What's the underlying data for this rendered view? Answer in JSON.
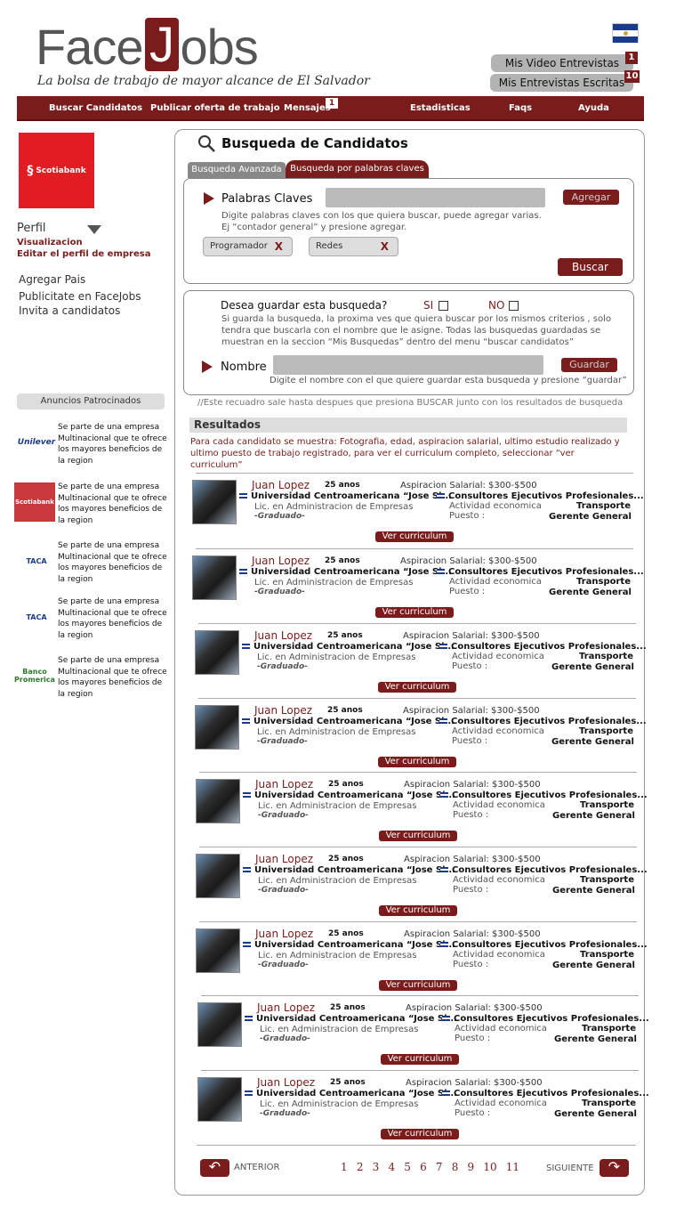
{
  "header": {
    "logo_text_a": "Face",
    "logo_text_j": "J",
    "logo_text_b": "obs",
    "tagline": "La bolsa de trabajo de mayor alcance de El Salvador",
    "video_btn": "Mis Video Entrevistas",
    "video_count": "1",
    "written_btn": "Mis Entrevistas Escritas",
    "written_count": "10"
  },
  "nav": {
    "items": [
      "Buscar Candidatos",
      "Publicar oferta de trabajo",
      "Mensajes",
      "Estadisticas",
      "Faqs",
      "Ayuda"
    ],
    "messages_count": "1"
  },
  "sidebar": {
    "company_logo": "Scotiabank",
    "perfil": "Perfil",
    "visualizacion": "Visualizacion",
    "edit_profile": "Editar el perfil de empresa",
    "links": [
      "Agregar Pais",
      "Publicitate en FaceJobs",
      "Invita a candidatos"
    ],
    "ads_title": "Anuncios Patrocinados",
    "ads": [
      {
        "logo": "Unilever",
        "text": "Se parte de una empresa Multinacional que te ofrece los mayores beneficios de la region"
      },
      {
        "logo": "Scotiabank",
        "text": "Se parte de una empresa Multinacional que te ofrece los mayores beneficios de la region"
      },
      {
        "logo": "TACA",
        "text": "Se parte de una empresa Multinacional que te ofrece los mayores beneficios de la region"
      },
      {
        "logo": "TACA",
        "text": "Se parte de una empresa Multinacional que te ofrece los mayores beneficios de la region"
      },
      {
        "logo": "Banco Promerica",
        "text": "Se parte de una empresa Multinacional que te ofrece los mayores beneficios de la region"
      }
    ]
  },
  "search": {
    "title": "Busqueda de Candidatos",
    "tab_advanced": "Busqueda Avanzada",
    "tab_keywords": "Busqueda por palabras claves",
    "keywords_label": "Palabras Claves",
    "add_btn": "Agregar",
    "keywords_hint1": "Digite palabras claves con los que quiera buscar, puede agregar varias.",
    "keywords_hint2": "Ej “contador general”  y presione agregar.",
    "tags": [
      "Programador",
      "Redes"
    ],
    "tag_remove": "X",
    "search_btn": "Buscar",
    "save_question": "Desea guardar esta busqueda?",
    "yes": "SI",
    "no": "NO",
    "save_hint": "Si guarda la busqueda, la proxima ves que quiera buscar por los mismos criterios , solo tendra que buscarla  con el nombre que le asigne. Todas las busquedas guardadas se muestran   en la seccion  “Mis Busquedas” dentro del menu “buscar candidatos”",
    "name_label": "Nombre",
    "save_btn": "Guardar",
    "name_hint": "Digite el nombre con el que quiere guardar esta busqueda y presione “guardar”",
    "note": "//Este recuadro sale hasta despues que presiona BUSCAR junto con los resultados de busqueda"
  },
  "results": {
    "title": "Resultados",
    "description": "Para cada candidato se muestra: Fotografia, edad, aspiracion salarial, ultimo estudio realizado y ultimo puesto de trabajo registrado, para ver el curriculum completo, seleccionar “ver curriculum”",
    "items": [
      {
        "name": "Juan Lopez",
        "age": "25 anos",
        "salary": "Aspiracion Salarial: $300-$500",
        "university": "Universidad Centroamericana “Jose Si...",
        "degree": "Lic. en Administracion de Empresas",
        "status": "-Graduado-",
        "company": "Consultores Ejecutivos Profesionales...",
        "activity_label": "Actividad economica",
        "activity": "Transporte",
        "position_label": "Puesto :",
        "position": "Gerente General",
        "cv": "Ver curriculum"
      },
      {
        "name": "Juan Lopez",
        "age": "25 anos",
        "salary": "Aspiracion Salarial: $300-$500",
        "university": "Universidad Centroamericana “Jose Si...",
        "degree": "Lic. en Administracion de Empresas",
        "status": "-Graduado-",
        "company": "Consultores Ejecutivos Profesionales...",
        "activity_label": "Actividad economica",
        "activity": "Transporte",
        "position_label": "Puesto :",
        "position": "Gerente General",
        "cv": "Ver curriculum"
      },
      {
        "name": "Juan Lopez",
        "age": "25 anos",
        "salary": "Aspiracion Salarial: $300-$500",
        "university": "Universidad Centroamericana “Jose Si...",
        "degree": "Lic. en Administracion de Empresas",
        "status": "-Graduado-",
        "company": "Consultores Ejecutivos Profesionales...",
        "activity_label": "Actividad economica",
        "activity": "Transporte",
        "position_label": "Puesto :",
        "position": "Gerente General",
        "cv": "Ver curriculum"
      },
      {
        "name": "Juan Lopez",
        "age": "25 anos",
        "salary": "Aspiracion Salarial: $300-$500",
        "university": "Universidad Centroamericana “Jose Si...",
        "degree": "Lic. en Administracion de Empresas",
        "status": "-Graduado-",
        "company": "Consultores Ejecutivos Profesionales...",
        "activity_label": "Actividad economica",
        "activity": "Transporte",
        "position_label": "Puesto :",
        "position": "Gerente General",
        "cv": "Ver curriculum"
      },
      {
        "name": "Juan Lopez",
        "age": "25 anos",
        "salary": "Aspiracion Salarial: $300-$500",
        "university": "Universidad Centroamericana “Jose Si...",
        "degree": "Lic. en Administracion de Empresas",
        "status": "-Graduado-",
        "company": "Consultores Ejecutivos Profesionales...",
        "activity_label": "Actividad economica",
        "activity": "Transporte",
        "position_label": "Puesto :",
        "position": "Gerente General",
        "cv": "Ver curriculum"
      },
      {
        "name": "Juan Lopez",
        "age": "25 anos",
        "salary": "Aspiracion Salarial: $300-$500",
        "university": "Universidad Centroamericana “Jose Si...",
        "degree": "Lic. en Administracion de Empresas",
        "status": "-Graduado-",
        "company": "Consultores Ejecutivos Profesionales...",
        "activity_label": "Actividad economica",
        "activity": "Transporte",
        "position_label": "Puesto :",
        "position": "Gerente General",
        "cv": "Ver curriculum"
      },
      {
        "name": "Juan Lopez",
        "age": "25 anos",
        "salary": "Aspiracion Salarial: $300-$500",
        "university": "Universidad Centroamericana “Jose Si...",
        "degree": "Lic. en Administracion de Empresas",
        "status": "-Graduado-",
        "company": "Consultores Ejecutivos Profesionales...",
        "activity_label": "Actividad economica",
        "activity": "Transporte",
        "position_label": "Puesto :",
        "position": "Gerente General",
        "cv": "Ver curriculum"
      },
      {
        "name": "Juan Lopez",
        "age": "25 anos",
        "salary": "Aspiracion Salarial: $300-$500",
        "university": "Universidad Centroamericana “Jose Si...",
        "degree": "Lic. en Administracion de Empresas",
        "status": "-Graduado-",
        "company": "Consultores Ejecutivos Profesionales...",
        "activity_label": "Actividad economica",
        "activity": "Transporte",
        "position_label": "Puesto :",
        "position": "Gerente General",
        "cv": "Ver curriculum"
      },
      {
        "name": "Juan Lopez",
        "age": "25 anos",
        "salary": "Aspiracion Salarial: $300-$500",
        "university": "Universidad Centroamericana “Jose Si...",
        "degree": "Lic. en Administracion de Empresas",
        "status": "-Graduado-",
        "company": "Consultores Ejecutivos Profesionales...",
        "activity_label": "Actividad economica",
        "activity": "Transporte",
        "position_label": "Puesto :",
        "position": "Gerente General",
        "cv": "Ver curriculum"
      }
    ]
  },
  "pager": {
    "prev": "ANTERIOR",
    "next": "SIGUIENTE",
    "pages": [
      "1",
      "2",
      "3",
      "4",
      "5",
      "6",
      "7",
      "8",
      "9",
      "10",
      "11"
    ]
  },
  "colors": {
    "brand": "#7a1c1c",
    "gray_button": "#b3b3b3"
  }
}
